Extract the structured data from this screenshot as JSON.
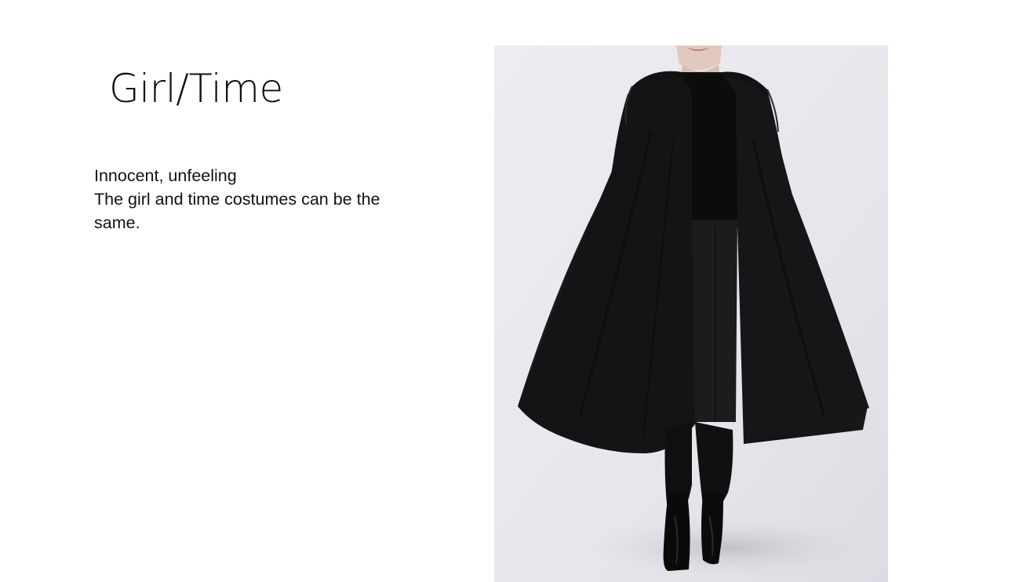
{
  "slide": {
    "title": "Girl/Time",
    "body_lines": [
      "Innocent, unfeeling",
      "The girl and time costumes can be the same."
    ]
  },
  "photo": {
    "subject": "model-in-black-hooded-cape",
    "colors": {
      "backdrop": "#e9e9ee",
      "garment": "#121212",
      "skin": "#e2c9bf"
    }
  }
}
